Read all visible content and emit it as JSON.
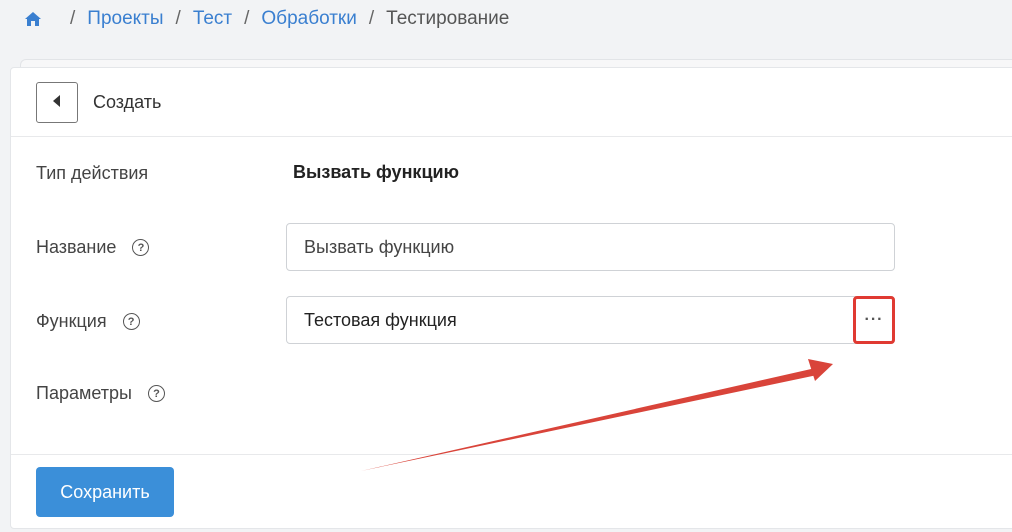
{
  "breadcrumb": {
    "home_icon": "home-icon",
    "items": [
      "Проекты",
      "Тест",
      "Обработки"
    ],
    "current": "Тестирование",
    "separator": "/"
  },
  "header": {
    "back_icon": "caret-left-icon",
    "title": "Создать"
  },
  "form": {
    "action_type": {
      "label": "Тип действия",
      "value": "Вызвать функцию"
    },
    "name": {
      "label": "Название",
      "value": "Вызвать функцию"
    },
    "function": {
      "label": "Функция",
      "value": "Тестовая функция",
      "picker_label": "···"
    },
    "params": {
      "label": "Параметры"
    },
    "help_glyph": "?"
  },
  "footer": {
    "save_label": "Сохранить"
  },
  "colors": {
    "accent": "#3b8fd9",
    "link": "#3a7fd0",
    "highlight": "#e03a32"
  }
}
